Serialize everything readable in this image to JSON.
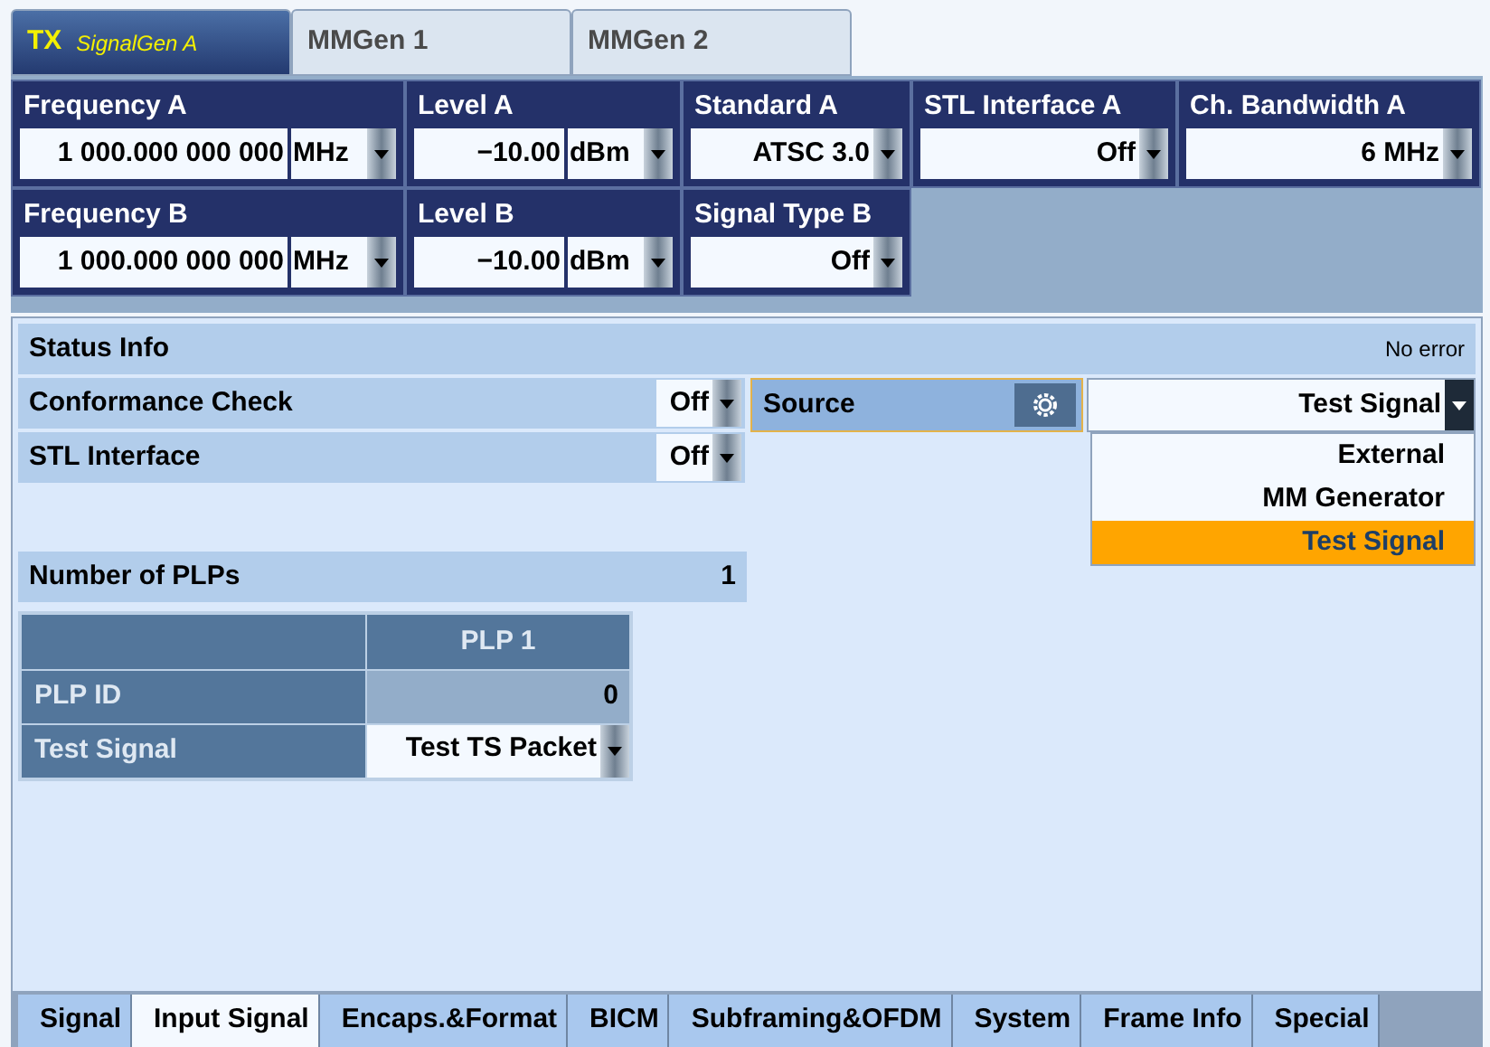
{
  "top_tabs": [
    {
      "label": "TX",
      "sublabel": "SignalGen A",
      "selected": true
    },
    {
      "label": "MMGen 1",
      "selected": false
    },
    {
      "label": "MMGen 2",
      "selected": false
    }
  ],
  "parameters": [
    [
      {
        "label": "Frequency A",
        "value": "1 000.000 000 000",
        "unit": "MHz"
      },
      {
        "label": "Level A",
        "value": "−10.00",
        "unit": "dBm"
      },
      {
        "label": "Standard A",
        "value": "ATSC 3.0"
      },
      {
        "label": "STL Interface A",
        "value": "Off"
      },
      {
        "label": "Ch. Bandwidth A",
        "value": "6 MHz"
      }
    ],
    [
      {
        "label": "Frequency B",
        "value": "1 000.000 000 000",
        "unit": "MHz"
      },
      {
        "label": "Level B",
        "value": "−10.00",
        "unit": "dBm"
      },
      {
        "label": "Signal Type B",
        "value": "Off"
      }
    ]
  ],
  "status_info": {
    "label": "Status Info",
    "message": "No error"
  },
  "settings": [
    {
      "label": "Conformance Check",
      "value": "Off"
    },
    {
      "label": "STL Interface",
      "value": "Off"
    }
  ],
  "source": {
    "label": "Source",
    "value": "Test Signal",
    "expanded": true,
    "options": [
      {
        "label": "External",
        "selected": false
      },
      {
        "label": "MM Generator",
        "selected": false
      },
      {
        "label": "Test Signal",
        "selected": true
      }
    ]
  },
  "number_of_plps": {
    "label": "Number of PLPs",
    "value": "1"
  },
  "plp_table": {
    "columns": [
      "PLP 1"
    ],
    "rows": [
      {
        "label": "PLP ID",
        "kind": "text",
        "value": "0"
      },
      {
        "label": "Test Signal",
        "kind": "dropdown",
        "value": "Test TS Packet"
      }
    ]
  },
  "bottom_tabs": [
    {
      "label": "Signal",
      "selected": false
    },
    {
      "label": "Input Signal",
      "selected": true
    },
    {
      "label": "Encaps.&Format",
      "selected": false
    },
    {
      "label": "BICM",
      "selected": false
    },
    {
      "label": "Subframing&OFDM",
      "selected": false
    },
    {
      "label": "System",
      "selected": false
    },
    {
      "label": "Frame Info",
      "selected": false
    },
    {
      "label": "Special",
      "selected": false
    }
  ]
}
